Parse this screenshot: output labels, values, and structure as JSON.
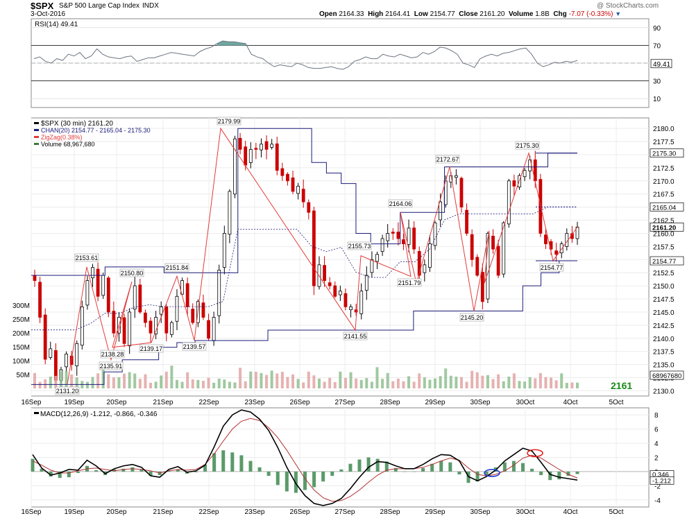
{
  "header": {
    "symbol": "$SPX",
    "name": "S&P 500 Large Cap Index",
    "exchange": "INDX",
    "date": "3-Oct-2016",
    "watermark": "@ StockCharts.com",
    "quote": {
      "open_label": "Open",
      "open": "2164.33",
      "high_label": "High",
      "high": "2164.41",
      "low_label": "Low",
      "low": "2154.77",
      "close_label": "Close",
      "close": "2161.20",
      "volume_label": "Volume",
      "volume": "1.8B",
      "chg_label": "Chg",
      "chg": "-7.07 (-0.33%)"
    }
  },
  "colors": {
    "up": "#000000",
    "down": "#cc0000",
    "channel": "#1a1a7a",
    "zigzag": "#e23a3a",
    "volume": "#8fbf8f",
    "volume_down": "#e2a4a4",
    "rsi": "#6b7380",
    "rsi_fill": "#6ea7a0",
    "macd": "#000000",
    "signal": "#b03030",
    "hist": "#5b9a6a",
    "last_value": "#1a8a1a"
  },
  "chart_data": [
    {
      "type": "line",
      "title": "RSI(14) 49.41",
      "legend": "top-left",
      "ylim": [
        0,
        100
      ],
      "y_ticks": [
        "90",
        "70",
        "50",
        "30",
        "10"
      ],
      "reference_lines": [
        70,
        30
      ],
      "current_value": "49.41",
      "series": [
        {
          "name": "RSI(14)",
          "values": [
            55,
            57,
            52,
            50,
            55,
            53,
            60,
            58,
            62,
            55,
            58,
            66,
            60,
            57,
            56,
            55,
            57,
            58,
            52,
            54,
            56,
            56,
            58,
            60,
            62,
            61,
            60,
            59,
            58,
            63,
            66,
            68,
            72,
            75,
            74,
            74,
            73,
            72,
            60,
            57,
            55,
            50,
            46,
            48,
            47,
            46,
            50,
            48,
            45,
            44,
            44,
            45,
            46,
            44,
            43,
            46,
            52,
            54,
            57,
            55,
            55,
            60,
            58,
            57,
            60,
            58,
            56,
            57,
            62,
            60,
            63,
            68,
            67,
            64,
            60,
            50,
            48,
            45,
            55,
            58,
            60,
            58,
            61,
            62,
            64,
            66,
            67,
            60,
            50,
            46,
            48,
            51,
            50,
            52,
            51,
            53
          ]
        }
      ]
    },
    {
      "type": "candlestick",
      "title": "$SPX (30 min) 2161.20",
      "legend": "top-left",
      "legend_entries": [
        "$SPX (30 min) 2161.20",
        "CHAN(20) 2154.77 - 2165.04 - 2175.30",
        "ZigZag(0.38%)",
        "Volume 68,967,680"
      ],
      "x": [
        "16Sep",
        "19Sep",
        "20Sep",
        "21Sep",
        "22Sep",
        "23Sep",
        "26Sep",
        "27Sep",
        "28Sep",
        "29Sep",
        "30Sep",
        "30Oct",
        "4Oct",
        "5Oct"
      ],
      "y_ticks": [
        "2180.0",
        "2177.5",
        "2175.0",
        "2172.5",
        "2170.0",
        "2167.5",
        "2165.0",
        "2162.5",
        "2160.0",
        "2157.5",
        "2155.0",
        "2152.5",
        "2150.0",
        "2147.5",
        "2145.0",
        "2142.5",
        "2140.0",
        "2137.5",
        "2135.0",
        "2132.5",
        "2130.0"
      ],
      "ylim": [
        2129.0,
        2182.0
      ],
      "price_tags": [
        "2175.30",
        "2165.04",
        "2161.20",
        "2154.77",
        "68967680"
      ],
      "last_value": "2161",
      "volume_ticks": [
        "300M",
        "250M",
        "200M",
        "150M",
        "100M",
        "50M"
      ],
      "series": [
        {
          "name": "$SPX (30 min)",
          "values": [
            2151.0,
            2144.0,
            2136.0,
            2138.0,
            2132.0,
            2134.0,
            2137.0,
            2135.0,
            2139.0,
            2146.0,
            2151.0,
            2153.5,
            2148.0,
            2152.0,
            2145.0,
            2141.0,
            2144.0,
            2139.0,
            2145.0,
            2150.0,
            2145.0,
            2143.0,
            2141.0,
            2144.0,
            2146.0,
            2141.0,
            2143.0,
            2148.0,
            2151.0,
            2146.0,
            2143.0,
            2147.0,
            2144.0,
            2140.0,
            2144.0,
            2153.0,
            2160.0,
            2168.0,
            2178.0,
            2176.0,
            2173.0,
            2176.0,
            2176.0,
            2177.0,
            2176.0,
            2177.0,
            2172.0,
            2171.0,
            2170.0,
            2168.0,
            2169.0,
            2166.0,
            2164.0,
            2150.0,
            2154.0,
            2151.0,
            2150.0,
            2148.0,
            2149.0,
            2146.0,
            2146.0,
            2145.0,
            2149.0,
            2152.0,
            2155.0,
            2156.0,
            2159.0,
            2160.0,
            2160.0,
            2159.0,
            2158.0,
            2161.0,
            2157.0,
            2152.0,
            2154.0,
            2158.0,
            2162.0,
            2166.0,
            2170.0,
            2171.0,
            2171.0,
            2165.0,
            2160.0,
            2155.0,
            2152.0,
            2147.0,
            2160.0,
            2157.0,
            2152.0,
            2162.0,
            2170.0,
            2169.0,
            2171.0,
            2172.0,
            2174.0,
            2170.0,
            2160.0,
            2158.0,
            2157.0,
            2156.0,
            2158.0,
            2160.0,
            2159.0,
            2161.2
          ]
        },
        {
          "name": "CHAN(20) upper",
          "values": [
            2152,
            2152,
            2152,
            2152,
            2152,
            2153.6,
            2153.6,
            2153.6,
            2153.6,
            2152.5,
            2152.5,
            2152.5,
            2152.5,
            2152.5,
            2179.99,
            2179.99,
            2179.99,
            2179.99,
            2179.99,
            2173.5,
            2171.5,
            2169.5,
            2160,
            2158,
            2158,
            2164,
            2164,
            2164,
            2172.67,
            2172.67,
            2172.67,
            2172.67,
            2172.67,
            2172.67,
            2172.67,
            2175.3,
            2175.3,
            2175.3
          ]
        },
        {
          "name": "CHAN(20) lower",
          "values": [
            2131.2,
            2131.2,
            2131.2,
            2131.2,
            2133.6,
            2135.91,
            2135.91,
            2138.28,
            2139.17,
            2139.57,
            2139.57,
            2139.57,
            2139.57,
            2141.55,
            2141.55,
            2141.55,
            2141.55,
            2141.55,
            2141.55,
            2141.55,
            2141.55,
            2145.2,
            2145.2,
            2145.2,
            2145.2,
            2145.2,
            2145.2,
            2150,
            2152.5,
            2154.77,
            2154.77
          ]
        },
        {
          "name": "ZigZag(0.38%)",
          "values": [
            2131.2,
            2153.61,
            2135.91,
            2150.8,
            2138.28,
            2139.17,
            2151.84,
            2139.57,
            2179.99,
            2141.55,
            2155.73,
            2151.79,
            2164.06,
            2150.5,
            2172.67,
            2145.2,
            2160.5,
            2150.5,
            2175.3,
            2154.77,
            2161.2
          ]
        }
      ],
      "annotations": [
        "2131.20",
        "2153.61",
        "2135.91",
        "2150.80",
        "2138.28",
        "2139.17",
        "2151.84",
        "2139.57",
        "2179.99",
        "2141.55",
        "2155.73",
        "2151.79",
        "2164.06",
        "2172.67",
        "2145.20",
        "2175.30",
        "2154.77"
      ]
    },
    {
      "type": "line",
      "title": "MACD(12,26,9) -1.212, -0.866, -0.346",
      "legend": "top-left",
      "ylim": [
        -5,
        9
      ],
      "y_ticks": [
        "8",
        "6",
        "4",
        "2",
        "0",
        "-2",
        "-4"
      ],
      "price_tags": [
        "0.346",
        "-1.212"
      ],
      "x": [
        "16Sep",
        "19Sep",
        "20Sep",
        "21Sep",
        "22Sep",
        "23Sep",
        "26Sep",
        "27Sep",
        "28Sep",
        "29Sep",
        "30Sep",
        "30Oct",
        "4Oct",
        "5Oct"
      ],
      "series": [
        {
          "name": "MACD",
          "values": [
            2.4,
            0.5,
            -0.5,
            -0.2,
            0.3,
            0.2,
            1.6,
            0.8,
            -0.3,
            0.4,
            0.8,
            1.0,
            0.6,
            -0.6,
            -0.8,
            0.3,
            0.7,
            -0.1,
            0.1,
            0.9,
            3.5,
            6.4,
            8.0,
            8.7,
            8.4,
            7.4,
            5.8,
            3.4,
            0.6,
            -1.7,
            -3.4,
            -4.5,
            -4.8,
            -4.5,
            -3.8,
            -2.4,
            -0.8,
            0.6,
            1.4,
            1.3,
            0.8,
            0.4,
            0.4,
            1.0,
            1.8,
            2.4,
            2.3,
            1.5,
            -0.7,
            -1.3,
            -0.7,
            0.2,
            1.5,
            2.4,
            3.3,
            2.9,
            1.3,
            -0.4,
            -0.8,
            -1.0,
            -1.2
          ]
        },
        {
          "name": "Signal",
          "values": [
            1.5,
            0.9,
            0.2,
            -0.2,
            -0.2,
            0.1,
            0.4,
            0.5,
            0.3,
            0.1,
            0.3,
            0.4,
            0.3,
            0.1,
            -0.2,
            0.1,
            0.3,
            0.2,
            0.3,
            1.0,
            2.5,
            4.3,
            6.0,
            7.1,
            7.5,
            7.2,
            6.2,
            4.8,
            3.0,
            1.0,
            -1.0,
            -2.6,
            -3.7,
            -4.2,
            -4.1,
            -3.5,
            -2.6,
            -1.5,
            -0.5,
            0.2,
            0.4,
            0.4,
            0.4,
            0.6,
            1.0,
            1.5,
            1.9,
            1.6,
            0.5,
            -0.4,
            -0.6,
            -0.4,
            0.1,
            0.9,
            1.9,
            2.3,
            1.9,
            1.1,
            0.3,
            -0.4,
            -0.9
          ]
        },
        {
          "name": "Histogram",
          "values": [
            1.8,
            0.4,
            -0.7,
            -0.9,
            -0.8,
            -0.2,
            0.8,
            0.2,
            -0.5,
            0.3,
            0.4,
            0.6,
            0.3,
            -0.6,
            -0.5,
            0.1,
            0.3,
            -0.3,
            -0.1,
            1.0,
            2.6,
            3.0,
            2.7,
            2.3,
            1.5,
            0.6,
            -0.6,
            -1.9,
            -2.8,
            -3.0,
            -2.6,
            -2.2,
            -1.4,
            -0.6,
            0.3,
            1.1,
            1.7,
            2.0,
            1.8,
            1.4,
            0.5,
            0.0,
            0.0,
            0.5,
            1.1,
            1.5,
            1.3,
            -0.4,
            -1.6,
            -1.4,
            -0.6,
            0.6,
            1.3,
            1.5,
            1.2,
            0.4,
            -0.5,
            -1.2,
            -1.1,
            -0.6,
            -0.35
          ]
        }
      ]
    }
  ]
}
